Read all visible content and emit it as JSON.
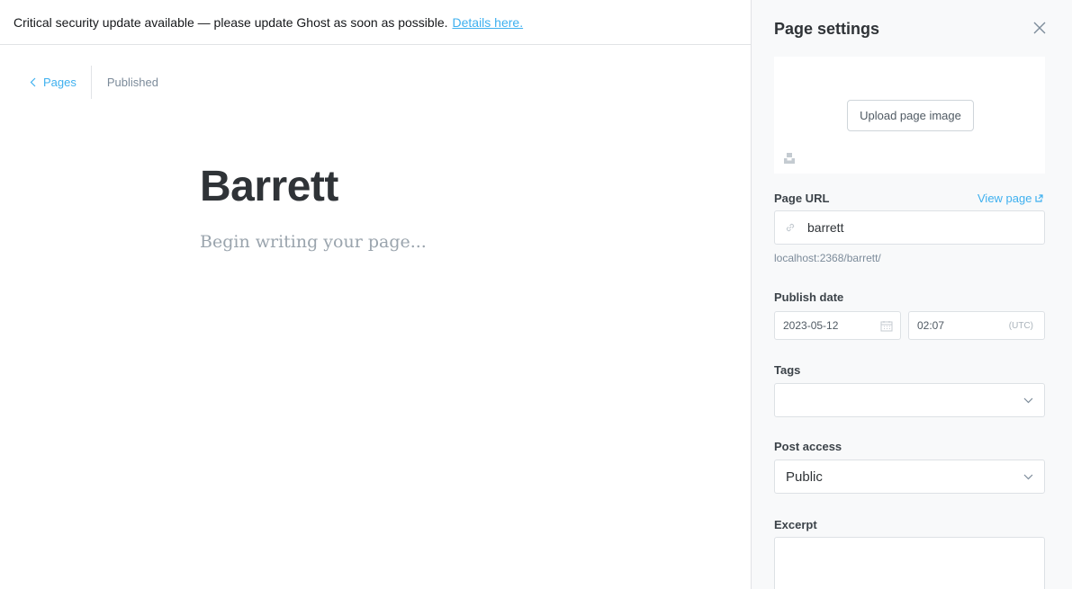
{
  "alert": {
    "message": "Critical security update available — please update Ghost as soon as possible.",
    "link_label": "Details here."
  },
  "editor": {
    "back_label": "Pages",
    "status": "Published",
    "title": "Barrett",
    "body_placeholder": "Begin writing your page..."
  },
  "settings": {
    "title": "Page settings",
    "upload_label": "Upload page image",
    "url_label": "Page URL",
    "view_page_label": "View page",
    "slug": "barrett",
    "url_hint": "localhost:2368/barrett/",
    "publish_label": "Publish date",
    "date": "2023-05-12",
    "time": "02:07",
    "timezone": "(UTC)",
    "tags_label": "Tags",
    "access_label": "Post access",
    "access_value": "Public",
    "excerpt_label": "Excerpt"
  },
  "colors": {
    "accent": "#3eb0ef",
    "panel_bg": "#f8f9fa"
  },
  "icons": {
    "back": "chevron-left-icon",
    "close": "close-icon",
    "external": "external-link-icon",
    "link": "link-icon",
    "calendar": "calendar-icon",
    "dropdown": "chevron-down-icon",
    "unsplash": "unsplash-icon"
  }
}
